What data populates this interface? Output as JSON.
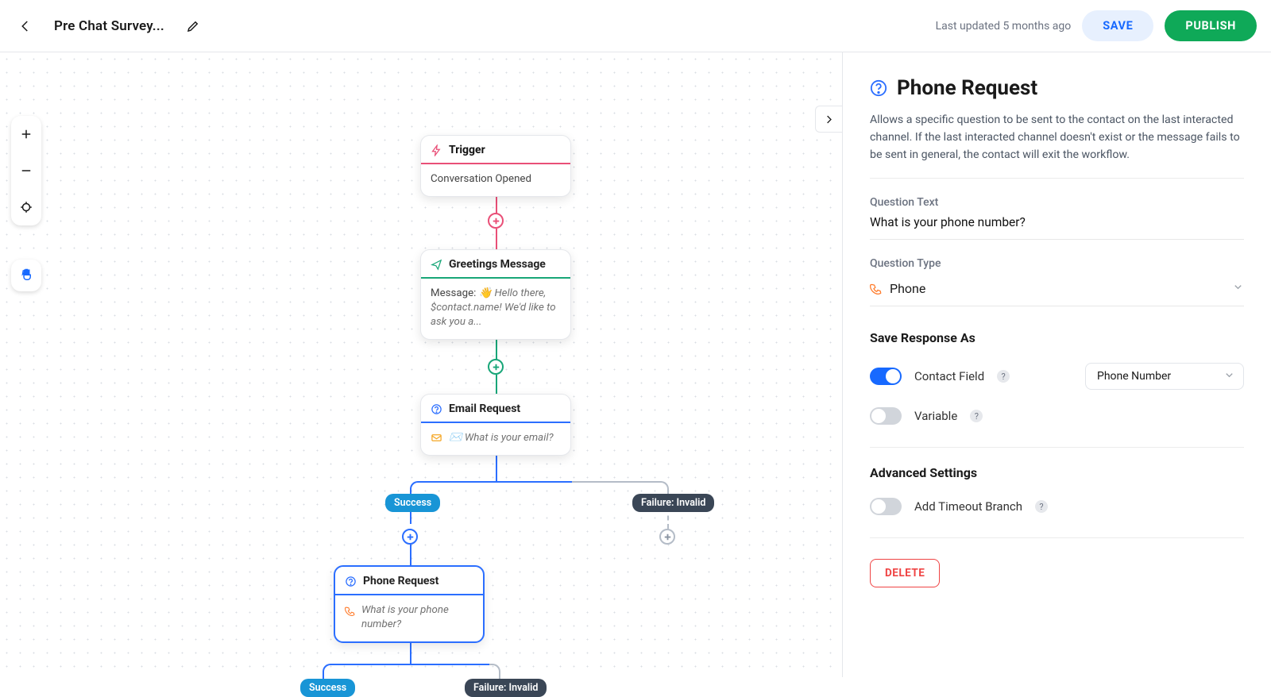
{
  "header": {
    "title": "Pre Chat Survey...",
    "last_updated": "Last updated 5 months ago",
    "save_label": "SAVE",
    "publish_label": "PUBLISH"
  },
  "canvas": {
    "nodes": {
      "trigger": {
        "title": "Trigger",
        "body": "Conversation Opened"
      },
      "greeting": {
        "title": "Greetings Message",
        "body_prefix": "Message: ",
        "body_italic": "👋 Hello there, $contact.name! We'd like to ask you a..."
      },
      "email_req": {
        "title": "Email Request",
        "body_italic": "✉️ What is your email?"
      },
      "phone_req": {
        "title": "Phone Request",
        "body_italic": "What is your phone number?"
      }
    },
    "pills": {
      "success": "Success",
      "fail": "Failure: Invalid"
    }
  },
  "panel": {
    "title": "Phone Request",
    "description": "Allows a specific question to be sent to the contact on the last interacted channel. If the last interacted channel doesn't exist or the message fails to be sent in general, the contact will exit the workflow.",
    "question_text_label": "Question Text",
    "question_text_value": "What is your phone number?",
    "question_type_label": "Question Type",
    "question_type_value": "Phone",
    "save_response_label": "Save Response As",
    "contact_field_label": "Contact Field",
    "contact_field_select": "Phone Number",
    "variable_label": "Variable",
    "advanced_label": "Advanced Settings",
    "timeout_label": "Add Timeout Branch",
    "delete_label": "DELETE"
  }
}
